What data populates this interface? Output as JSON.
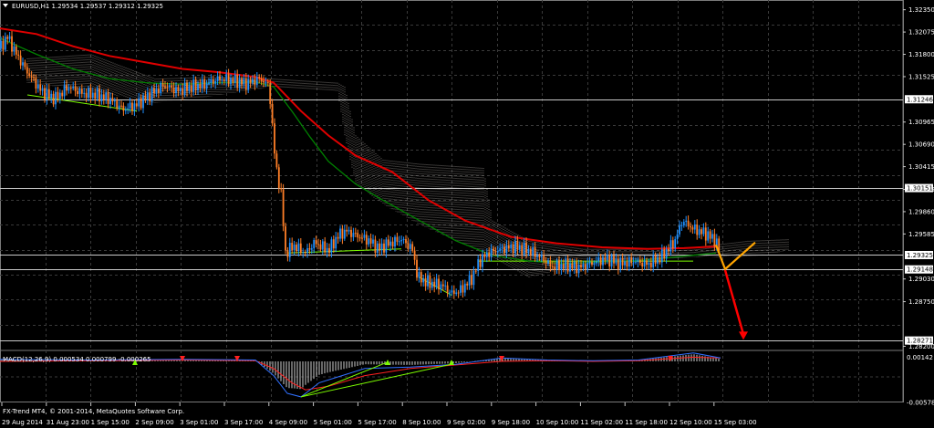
{
  "header": {
    "symbol": "EURUSD,H1",
    "ohlc": "1.29534 1.29537 1.29312 1.29325"
  },
  "macd": {
    "label": "MACD(12,26,9) 0.000534 0.000799 -0.000265",
    "ticks": [
      "0.00142",
      "-0.00578"
    ]
  },
  "footer": {
    "copyright": "FX-Trend MT4, © 2001-2014, MetaQuotes Software Corp."
  },
  "price_axis": {
    "ticks": [
      "1.32350",
      "1.32075",
      "1.31800",
      "1.31525",
      "1.30965",
      "1.30690",
      "1.30415",
      "1.30135",
      "1.29860",
      "1.29585",
      "1.29030",
      "1.28750",
      "1.28200"
    ],
    "tags": [
      "1.31246",
      "1.30151",
      "1.29325",
      "1.29148",
      "1.28271"
    ]
  },
  "time_axis": {
    "labels": [
      "29 Aug 2014",
      "31 Aug 23:00",
      "1 Sep 15:00",
      "2 Sep 09:00",
      "3 Sep 01:00",
      "3 Sep 17:00",
      "4 Sep 09:00",
      "5 Sep 01:00",
      "5 Sep 17:00",
      "8 Sep 10:00",
      "9 Sep 02:00",
      "9 Sep 18:00",
      "10 Sep 10:00",
      "11 Sep 02:00",
      "11 Sep 18:00",
      "12 Sep 10:00",
      "15 Sep 03:00"
    ]
  },
  "colors": {
    "background": "#000000",
    "grid": "#3a3a3a",
    "candle_up": "#1e90ff",
    "candle_down": "#ff7f27",
    "ma_slow": "#e00000",
    "ma_fast": "#008000",
    "trend_line": "#7cfc00",
    "cloud": "#d8d0c8",
    "forecast_up": "#ffa500",
    "forecast_down": "#ff0000"
  },
  "chart_data": {
    "type": "line",
    "instrument": "EURUSD",
    "timeframe": "H1",
    "ylim": [
      1.2816,
      1.3247
    ],
    "price_path": [
      [
        0,
        1.3187
      ],
      [
        8,
        1.3202
      ],
      [
        18,
        1.318
      ],
      [
        30,
        1.3158
      ],
      [
        45,
        1.3135
      ],
      [
        60,
        1.3125
      ],
      [
        75,
        1.314
      ],
      [
        90,
        1.3132
      ],
      [
        105,
        1.313
      ],
      [
        120,
        1.3125
      ],
      [
        135,
        1.3112
      ],
      [
        150,
        1.3118
      ],
      [
        165,
        1.3131
      ],
      [
        180,
        1.3142
      ],
      [
        195,
        1.3135
      ],
      [
        210,
        1.314
      ],
      [
        225,
        1.3143
      ],
      [
        240,
        1.315
      ],
      [
        255,
        1.3148
      ],
      [
        270,
        1.3144
      ],
      [
        285,
        1.315
      ],
      [
        295,
        1.3141
      ],
      [
        302,
        1.3045
      ],
      [
        308,
        1.301
      ],
      [
        313,
        1.2935
      ],
      [
        322,
        1.2944
      ],
      [
        335,
        1.2935
      ],
      [
        345,
        1.2948
      ],
      [
        360,
        1.2938
      ],
      [
        372,
        1.2958
      ],
      [
        380,
        1.2962
      ],
      [
        390,
        1.2957
      ],
      [
        405,
        1.295
      ],
      [
        415,
        1.294
      ],
      [
        425,
        1.2946
      ],
      [
        440,
        1.2952
      ],
      [
        452,
        1.294
      ],
      [
        458,
        1.2905
      ],
      [
        470,
        1.2898
      ],
      [
        485,
        1.2895
      ],
      [
        495,
        1.2885
      ],
      [
        505,
        1.2889
      ],
      [
        518,
        1.2905
      ],
      [
        525,
        1.2924
      ],
      [
        535,
        1.2935
      ],
      [
        550,
        1.294
      ],
      [
        565,
        1.2943
      ],
      [
        580,
        1.2938
      ],
      [
        595,
        1.2928
      ],
      [
        605,
        1.2918
      ],
      [
        620,
        1.292
      ],
      [
        635,
        1.2917
      ],
      [
        650,
        1.2923
      ],
      [
        665,
        1.2928
      ],
      [
        680,
        1.2922
      ],
      [
        695,
        1.2925
      ],
      [
        710,
        1.2921
      ],
      [
        725,
        1.293
      ],
      [
        740,
        1.295
      ],
      [
        748,
        1.2975
      ],
      [
        760,
        1.2965
      ],
      [
        775,
        1.2958
      ],
      [
        785,
        1.295
      ],
      [
        790,
        1.2933
      ]
    ],
    "ma_slow": [
      [
        0,
        1.3212
      ],
      [
        40,
        1.3205
      ],
      [
        80,
        1.319
      ],
      [
        120,
        1.3178
      ],
      [
        160,
        1.317
      ],
      [
        200,
        1.3162
      ],
      [
        240,
        1.3158
      ],
      [
        280,
        1.3152
      ],
      [
        300,
        1.3145
      ],
      [
        330,
        1.311
      ],
      [
        360,
        1.308
      ],
      [
        390,
        1.3055
      ],
      [
        430,
        1.3035
      ],
      [
        470,
        1.3
      ],
      [
        510,
        1.2975
      ],
      [
        560,
        1.2955
      ],
      [
        610,
        1.2947
      ],
      [
        660,
        1.2942
      ],
      [
        710,
        1.294
      ],
      [
        750,
        1.2941
      ],
      [
        785,
        1.2943
      ]
    ],
    "ma_fast": [
      [
        0,
        1.32
      ],
      [
        40,
        1.318
      ],
      [
        80,
        1.3162
      ],
      [
        120,
        1.315
      ],
      [
        160,
        1.3145
      ],
      [
        200,
        1.3143
      ],
      [
        240,
        1.3145
      ],
      [
        280,
        1.3146
      ],
      [
        300,
        1.314
      ],
      [
        320,
        1.311
      ],
      [
        340,
        1.3078
      ],
      [
        360,
        1.3048
      ],
      [
        390,
        1.302
      ],
      [
        420,
        1.3
      ],
      [
        460,
        1.2975
      ],
      [
        500,
        1.295
      ],
      [
        540,
        1.2932
      ],
      [
        580,
        1.2925
      ],
      [
        620,
        1.2922
      ],
      [
        660,
        1.2924
      ],
      [
        700,
        1.2926
      ],
      [
        740,
        1.293
      ],
      [
        785,
        1.2935
      ]
    ],
    "trend_lines": [
      [
        [
          30,
          1.313
        ],
        [
          150,
          1.311
        ]
      ],
      [
        [
          315,
          1.2935
        ],
        [
          440,
          1.294
        ]
      ],
      [
        [
          460,
          1.2905
        ],
        [
          495,
          1.2883
        ]
      ],
      [
        [
          525,
          1.2925
        ],
        [
          760,
          1.2925
        ]
      ]
    ],
    "cloud": [
      [
        30,
        1.3145,
        1.3175
      ],
      [
        100,
        1.3135,
        1.318
      ],
      [
        170,
        1.312,
        1.315
      ],
      [
        230,
        1.3128,
        1.3152
      ],
      [
        300,
        1.314,
        1.315
      ],
      [
        370,
        1.3135,
        1.3145
      ],
      [
        378,
        1.308,
        1.314
      ],
      [
        390,
        1.302,
        1.308
      ],
      [
        420,
        1.2995,
        1.305
      ],
      [
        460,
        1.297,
        1.3045
      ],
      [
        530,
        1.2935,
        1.304
      ],
      [
        540,
        1.293,
        1.2975
      ],
      [
        580,
        1.2905,
        1.295
      ],
      [
        640,
        1.292,
        1.294
      ],
      [
        700,
        1.2925,
        1.294
      ],
      [
        760,
        1.293,
        1.2942
      ],
      [
        820,
        1.293,
        1.295
      ],
      [
        865,
        1.2938,
        1.2952
      ]
    ],
    "forecast": {
      "up_path": [
        [
          785,
          1.2945
        ],
        [
          795,
          1.2915
        ],
        [
          828,
          1.2948
        ]
      ],
      "down_path": [
        [
          795,
          1.2914
        ],
        [
          815,
          1.2828
        ]
      ]
    },
    "horizontal_levels": [
      1.31246,
      1.30151,
      1.29325,
      1.29148,
      1.28271
    ],
    "macd": {
      "ylim": [
        -0.00578,
        0.00142
      ],
      "signal_path": [
        [
          0,
          0.0
        ],
        [
          100,
          0.0001
        ],
        [
          200,
          0.0002
        ],
        [
          280,
          0.0001
        ],
        [
          300,
          -0.001
        ],
        [
          320,
          -0.003
        ],
        [
          335,
          -0.004
        ],
        [
          360,
          -0.0035
        ],
        [
          400,
          -0.002
        ],
        [
          450,
          -0.001
        ],
        [
          500,
          -0.0005
        ],
        [
          550,
          0.0
        ],
        [
          600,
          0.0001
        ],
        [
          650,
          0.0
        ],
        [
          700,
          0.0001
        ],
        [
          760,
          0.0006
        ],
        [
          790,
          0.0005
        ]
      ],
      "macd_path": [
        [
          0,
          0.0003
        ],
        [
          100,
          0.0002
        ],
        [
          200,
          0.0003
        ],
        [
          280,
          0.0002
        ],
        [
          300,
          -0.002
        ],
        [
          315,
          -0.0045
        ],
        [
          330,
          -0.005
        ],
        [
          350,
          -0.003
        ],
        [
          400,
          -0.001
        ],
        [
          450,
          -0.0008
        ],
        [
          500,
          -0.0004
        ],
        [
          550,
          0.0005
        ],
        [
          600,
          0.0002
        ],
        [
          650,
          0.0001
        ],
        [
          700,
          0.0002
        ],
        [
          760,
          0.0012
        ],
        [
          790,
          0.0005
        ]
      ]
    }
  }
}
